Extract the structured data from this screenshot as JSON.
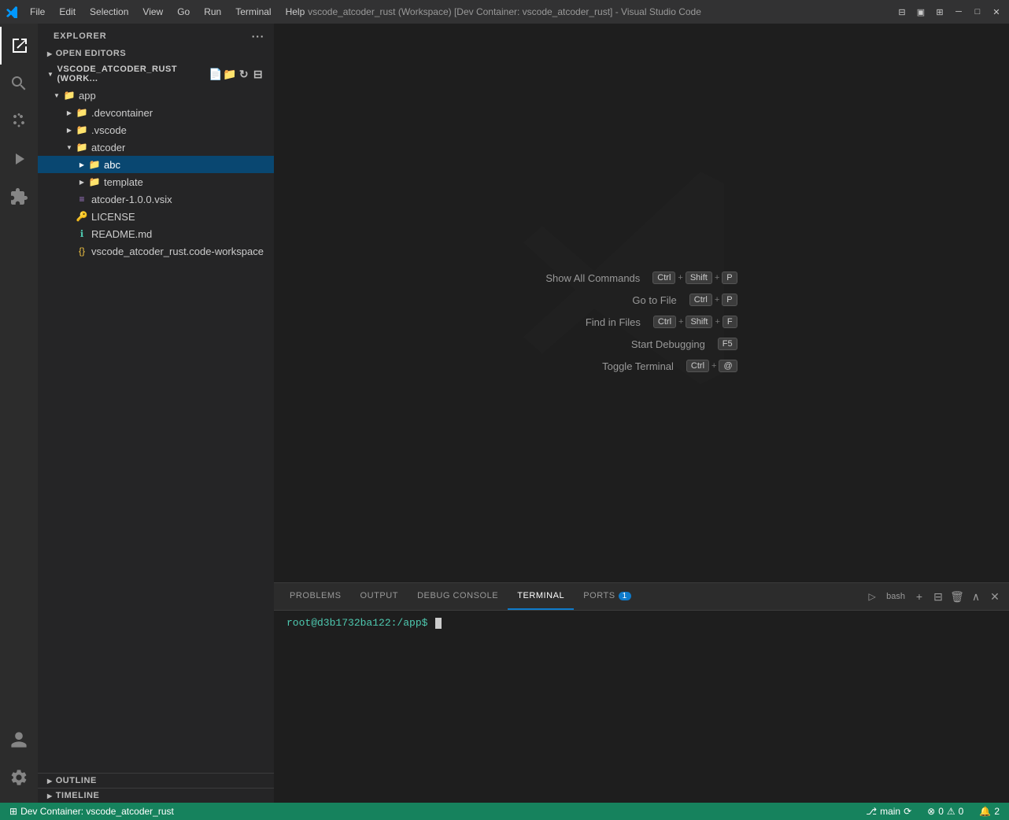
{
  "titlebar": {
    "title": "vscode_atcoder_rust (Workspace) [Dev Container: vscode_atcoder_rust] - Visual Studio Code",
    "menus": [
      "File",
      "Edit",
      "Selection",
      "View",
      "Go",
      "Run",
      "Terminal",
      "Help"
    ]
  },
  "sidebar": {
    "header": "Explorer",
    "section_open_editors": "Open Editors",
    "section_workspace": "VSCODE_ATCODER_RUST (WORK...",
    "tree": [
      {
        "id": "app",
        "label": "app",
        "type": "folder",
        "depth": 1,
        "expanded": true
      },
      {
        "id": "devcontainer",
        "label": ".devcontainer",
        "type": "folder",
        "depth": 2,
        "expanded": false
      },
      {
        "id": "vscode",
        "label": ".vscode",
        "type": "folder",
        "depth": 2,
        "expanded": false
      },
      {
        "id": "atcoder",
        "label": "atcoder",
        "type": "folder",
        "depth": 2,
        "expanded": true
      },
      {
        "id": "abc",
        "label": "abc",
        "type": "folder",
        "depth": 3,
        "expanded": false,
        "selected": true
      },
      {
        "id": "template",
        "label": "template",
        "type": "folder",
        "depth": 3,
        "expanded": false
      },
      {
        "id": "atcoder-vsix",
        "label": "atcoder-1.0.0.vsix",
        "type": "file-vsix",
        "depth": 2
      },
      {
        "id": "license",
        "label": "LICENSE",
        "type": "file-license",
        "depth": 2
      },
      {
        "id": "readme",
        "label": "README.md",
        "type": "file-md",
        "depth": 2
      },
      {
        "id": "workspace",
        "label": "vscode_atcoder_rust.code-workspace",
        "type": "file-workspace",
        "depth": 2
      }
    ],
    "outline_label": "Outline",
    "timeline_label": "Timeline"
  },
  "welcome": {
    "shortcuts": [
      {
        "label": "Show All Commands",
        "keys": [
          "Ctrl",
          "+",
          "Shift",
          "+",
          "P"
        ]
      },
      {
        "label": "Go to File",
        "keys": [
          "Ctrl",
          "+",
          "P"
        ]
      },
      {
        "label": "Find in Files",
        "keys": [
          "Ctrl",
          "+",
          "Shift",
          "+",
          "F"
        ]
      },
      {
        "label": "Start Debugging",
        "keys": [
          "F5"
        ]
      },
      {
        "label": "Toggle Terminal",
        "keys": [
          "Ctrl",
          "+",
          "@"
        ]
      }
    ]
  },
  "panel": {
    "tabs": [
      "PROBLEMS",
      "OUTPUT",
      "DEBUG CONSOLE",
      "TERMINAL",
      "PORTS"
    ],
    "active_tab": "TERMINAL",
    "ports_badge": "1",
    "terminal_prompt": "root@d3b1732ba122:/app$",
    "shell": "bash"
  },
  "statusbar": {
    "container": "Dev Container: vscode_atcoder_rust",
    "branch": "main",
    "sync_icon": "⟳",
    "errors": "0",
    "warnings": "0",
    "extensions": "2",
    "remote_icon": "⊞"
  }
}
